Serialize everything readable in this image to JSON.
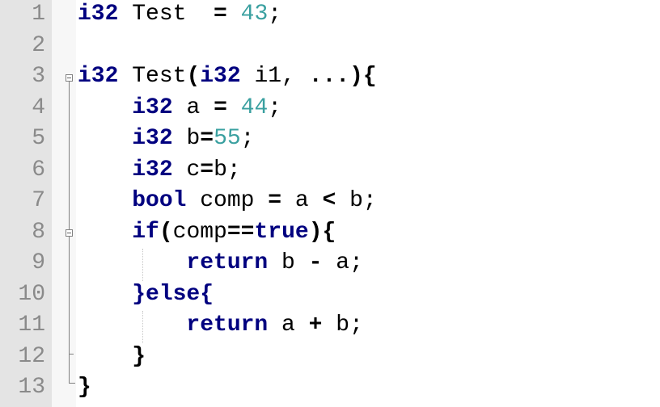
{
  "editor": {
    "lines": [
      {
        "num": "1",
        "tokens": [
          {
            "t": "i32",
            "c": "kw"
          },
          {
            "t": " Test  ",
            "c": "id"
          },
          {
            "t": "=",
            "c": "op"
          },
          {
            "t": " ",
            "c": "id"
          },
          {
            "t": "43",
            "c": "num"
          },
          {
            "t": ";",
            "c": "id"
          }
        ]
      },
      {
        "num": "2",
        "tokens": []
      },
      {
        "num": "3",
        "tokens": [
          {
            "t": "i32",
            "c": "kw"
          },
          {
            "t": " Test",
            "c": "id"
          },
          {
            "t": "(",
            "c": "op"
          },
          {
            "t": "i32",
            "c": "kw"
          },
          {
            "t": " i1, ",
            "c": "id"
          },
          {
            "t": "...",
            "c": "op"
          },
          {
            "t": "){",
            "c": "op"
          }
        ]
      },
      {
        "num": "4",
        "tokens": [
          {
            "t": "    ",
            "c": "id"
          },
          {
            "t": "i32",
            "c": "kw"
          },
          {
            "t": " a ",
            "c": "id"
          },
          {
            "t": "=",
            "c": "op"
          },
          {
            "t": " ",
            "c": "id"
          },
          {
            "t": "44",
            "c": "num"
          },
          {
            "t": ";",
            "c": "id"
          }
        ]
      },
      {
        "num": "5",
        "tokens": [
          {
            "t": "    ",
            "c": "id"
          },
          {
            "t": "i32",
            "c": "kw"
          },
          {
            "t": " b",
            "c": "id"
          },
          {
            "t": "=",
            "c": "op"
          },
          {
            "t": "55",
            "c": "num"
          },
          {
            "t": ";",
            "c": "id"
          }
        ]
      },
      {
        "num": "6",
        "tokens": [
          {
            "t": "    ",
            "c": "id"
          },
          {
            "t": "i32",
            "c": "kw"
          },
          {
            "t": " c",
            "c": "id"
          },
          {
            "t": "=",
            "c": "op"
          },
          {
            "t": "b;",
            "c": "id"
          }
        ]
      },
      {
        "num": "7",
        "tokens": [
          {
            "t": "    ",
            "c": "id"
          },
          {
            "t": "bool",
            "c": "kw"
          },
          {
            "t": " comp ",
            "c": "id"
          },
          {
            "t": "=",
            "c": "op"
          },
          {
            "t": " a ",
            "c": "id"
          },
          {
            "t": "<",
            "c": "op"
          },
          {
            "t": " b;",
            "c": "id"
          }
        ]
      },
      {
        "num": "8",
        "tokens": [
          {
            "t": "    ",
            "c": "id"
          },
          {
            "t": "if",
            "c": "kw"
          },
          {
            "t": "(",
            "c": "op"
          },
          {
            "t": "comp",
            "c": "id"
          },
          {
            "t": "==",
            "c": "op"
          },
          {
            "t": "true",
            "c": "kw"
          },
          {
            "t": "){",
            "c": "op"
          }
        ]
      },
      {
        "num": "9",
        "tokens": [
          {
            "t": "        ",
            "c": "id"
          },
          {
            "t": "return",
            "c": "kw"
          },
          {
            "t": " b ",
            "c": "id"
          },
          {
            "t": "-",
            "c": "op"
          },
          {
            "t": " a;",
            "c": "id"
          }
        ]
      },
      {
        "num": "10",
        "tokens": [
          {
            "t": "    ",
            "c": "id"
          },
          {
            "t": "}else{",
            "c": "kw"
          }
        ]
      },
      {
        "num": "11",
        "tokens": [
          {
            "t": "        ",
            "c": "id"
          },
          {
            "t": "return",
            "c": "kw"
          },
          {
            "t": " a ",
            "c": "id"
          },
          {
            "t": "+",
            "c": "op"
          },
          {
            "t": " b;",
            "c": "id"
          }
        ]
      },
      {
        "num": "12",
        "tokens": [
          {
            "t": "    ",
            "c": "id"
          },
          {
            "t": "}",
            "c": "op"
          }
        ]
      },
      {
        "num": "13",
        "tokens": [
          {
            "t": "}",
            "c": "op"
          }
        ]
      }
    ],
    "colors": {
      "keyword": "#00007f",
      "number": "#3aa0a0",
      "line_number": "#8a8a8a",
      "gutter_bg": "#e4e4e4",
      "fold_margin_bg": "#f7f7f7"
    }
  }
}
